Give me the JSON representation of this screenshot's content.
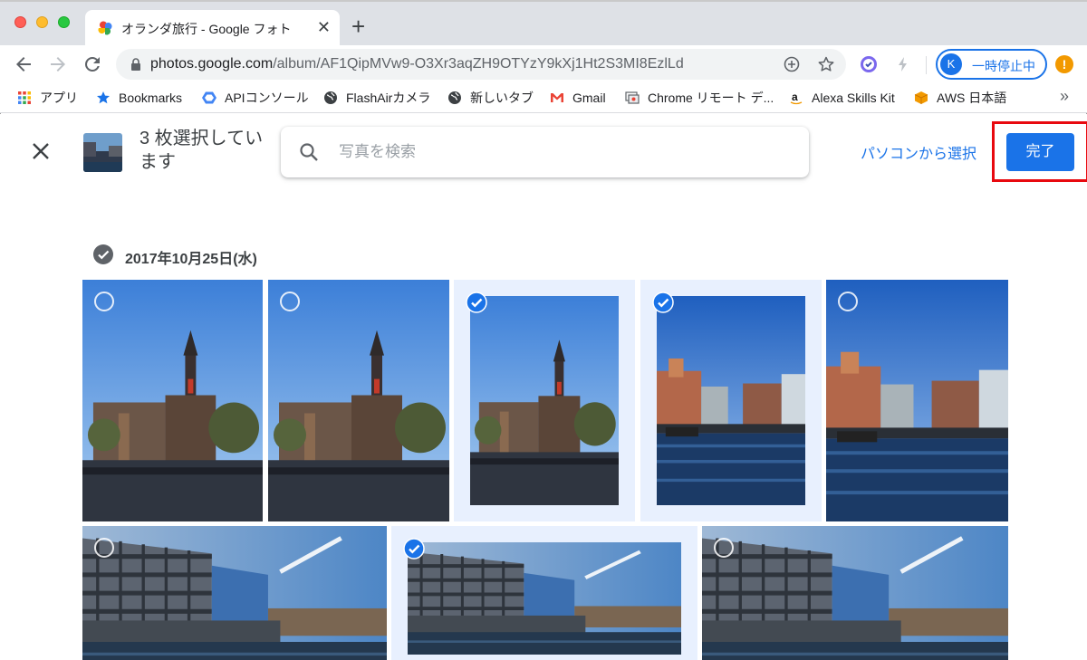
{
  "browser": {
    "tab": {
      "title": "オランダ旅行 - Google フォト",
      "close": "✕"
    },
    "new_tab": "+",
    "url": {
      "host": "photos.google.com",
      "path": "/album/AF1QipMVw9-O3Xr3aqZH9OTYzY9kXj1Ht2S3MI8EzlLd"
    },
    "profile": {
      "initial": "K",
      "label": "一時停止中"
    },
    "alert": "!",
    "bookmarks": [
      {
        "label": "アプリ",
        "icon": "apps-grid-icon"
      },
      {
        "label": "Bookmarks",
        "icon": "star-icon"
      },
      {
        "label": "APIコンソール",
        "icon": "api-hexagon-icon"
      },
      {
        "label": "FlashAirカメラ",
        "icon": "globe-icon"
      },
      {
        "label": "新しいタブ",
        "icon": "globe-icon"
      },
      {
        "label": "Gmail",
        "icon": "gmail-icon"
      },
      {
        "label": "Chrome リモート デ...",
        "icon": "chrome-remote-icon"
      },
      {
        "label": "Alexa Skills Kit",
        "icon": "amazon-icon"
      },
      {
        "label": "AWS 日本語",
        "icon": "aws-cube-icon"
      }
    ],
    "bookmarks_more": "»"
  },
  "picker": {
    "selected_count": "3 枚選択しています",
    "search": {
      "placeholder": "写真を検索",
      "value": ""
    },
    "from_pc": "パソコンから選択",
    "done": "完了",
    "date": "2017年10月25日(水)",
    "colors": {
      "accent": "#1a73e8",
      "highlight": "#e8090f",
      "selected_bg": "#e8f0fe"
    }
  },
  "photos": [
    {
      "scene": "church",
      "selected": false
    },
    {
      "scene": "church",
      "selected": false
    },
    {
      "scene": "church",
      "selected": true
    },
    {
      "scene": "canal",
      "selected": true
    },
    {
      "scene": "canal",
      "selected": false
    },
    {
      "scene": "building",
      "selected": false
    },
    {
      "scene": "building",
      "selected": true
    },
    {
      "scene": "building",
      "selected": false
    }
  ]
}
